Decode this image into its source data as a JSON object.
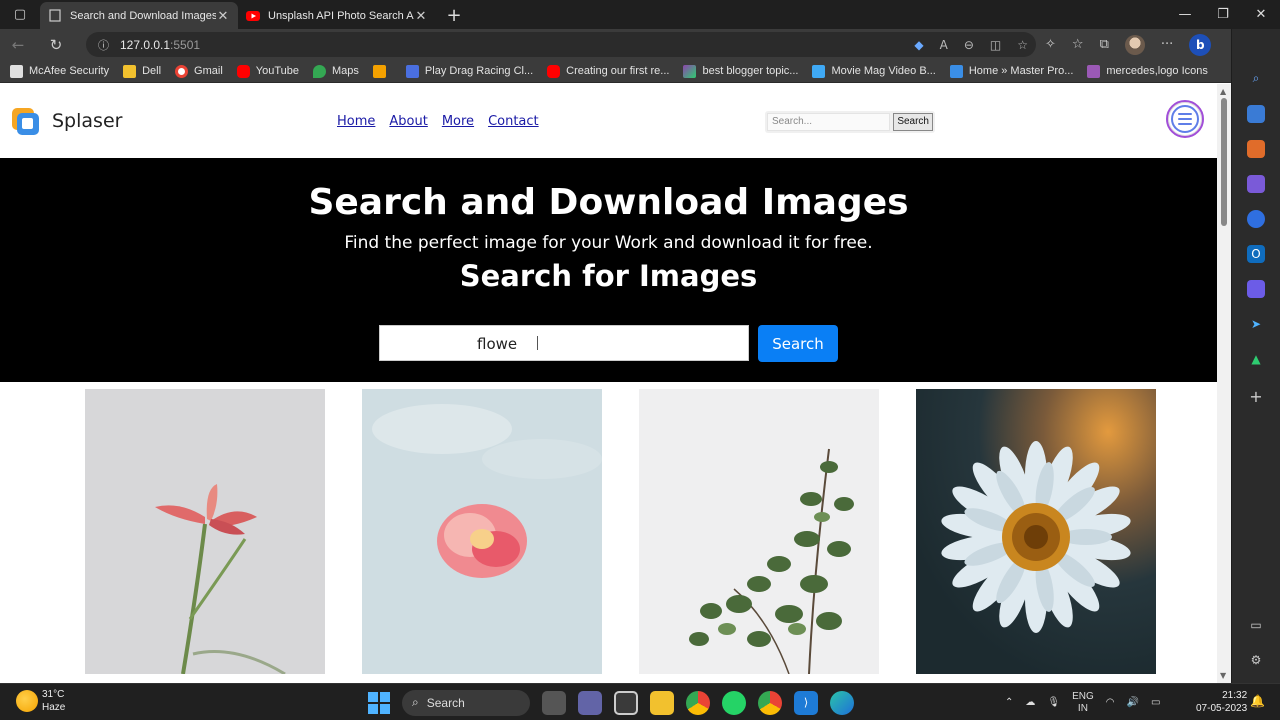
{
  "browser": {
    "tabs": [
      {
        "title": "Search and Download Images",
        "close": "✕"
      },
      {
        "title": "Unsplash API Photo Search App",
        "close": "✕"
      }
    ],
    "new_tab": "+",
    "url_host": "127.0.0.1",
    "url_port": ":5501",
    "bookmarks": [
      {
        "label": "McAfee Security",
        "color": "#e0e0e0"
      },
      {
        "label": "Dell",
        "color": "#f2c12e"
      },
      {
        "label": "Gmail",
        "color": "#ea4335"
      },
      {
        "label": "YouTube",
        "color": "#ff0000"
      },
      {
        "label": "Maps",
        "color": "#34a853"
      },
      {
        "label": "",
        "color": "#f4a100"
      },
      {
        "label": "Play Drag Racing Cl...",
        "color": "#4a6fe0"
      },
      {
        "label": "Creating our first re...",
        "color": "#ff0000"
      },
      {
        "label": "best blogger topic...",
        "color": "#8e44ad"
      },
      {
        "label": "Movie Mag Video B...",
        "color": "#3fa9f5"
      },
      {
        "label": "Home » Master Pro...",
        "color": "#3a8ee6"
      },
      {
        "label": "mercedes,logo Icons",
        "color": "#9b59b6"
      }
    ]
  },
  "site": {
    "brand": "Splaser",
    "menu": [
      "Home",
      "About",
      "More",
      "Contact"
    ],
    "header_search_placeholder": "Search...",
    "header_search_button": "Search"
  },
  "hero": {
    "title": "Search and Download Images",
    "subtitle": "Find the perfect image for your Work and download it for free.",
    "heading": "Search for Images",
    "query": "flowe",
    "button": "Search"
  },
  "taskbar": {
    "temp": "31°C",
    "weather": "Haze",
    "search": "Search",
    "lang_top": "ENG",
    "lang_bottom": "IN",
    "time": "21:32",
    "date": "07-05-2023"
  }
}
